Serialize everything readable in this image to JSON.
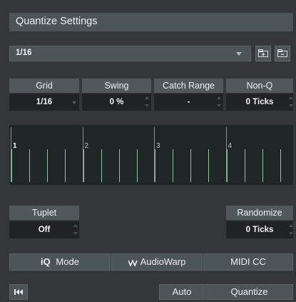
{
  "title": "Quantize Settings",
  "preset": {
    "value": "1/16"
  },
  "params": [
    {
      "label": "Grid",
      "value": "1/16"
    },
    {
      "label": "Swing",
      "value": "0 %"
    },
    {
      "label": "Catch Range",
      "value": "-"
    },
    {
      "label": "Non-Q",
      "value": "0 Ticks"
    }
  ],
  "grid": {
    "bars": [
      "1",
      "2",
      "3",
      "4"
    ],
    "subdivisions_per_bar": 4
  },
  "tuplet": {
    "label": "Tuplet",
    "value": "Off"
  },
  "randomize": {
    "label": "Randomize",
    "value": "0 Ticks"
  },
  "modes": {
    "iq_prefix": "iQ",
    "iq_label": "Mode",
    "audiowarp_label": "AudioWarp",
    "midicc_label": "MIDI CC"
  },
  "actions": {
    "auto_label": "Auto",
    "quantize_label": "Quantize"
  },
  "colors": {
    "panel": "#33373a",
    "accent_grid": "#8fc59b"
  }
}
